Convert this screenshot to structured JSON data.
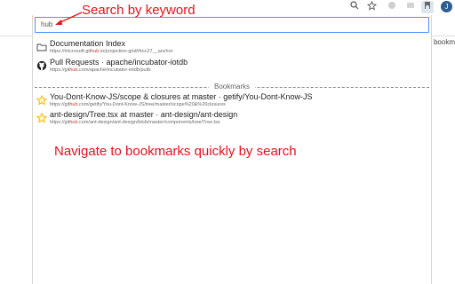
{
  "browser": {
    "toolbar_icons": [
      "search-icon",
      "star-icon",
      "extension-icon",
      "extension-icon",
      "bookmark-extension-icon",
      "profile-avatar"
    ],
    "avatar_letter": "J",
    "bookmarks_bar_fragment": "er bookm"
  },
  "search": {
    "value": "hub"
  },
  "annotations": {
    "search_hint": "Search by keyword",
    "navigate_hint": "Navigate to bookmarks quickly by search"
  },
  "results": [
    {
      "icon": "folder-icon",
      "title": "Documentation Index",
      "url_prefix": "https://microsoft.git",
      "url_hl": "hub",
      "url_suffix": ".io/projection-grid/#toc27__anchor"
    },
    {
      "icon": "github-icon",
      "title": "Pull Requests · apache/incubator-iotdb",
      "url_prefix": "https://git",
      "url_hl": "hub",
      "url_suffix": ".com/apache/incubator-iotdb/pulls"
    }
  ],
  "bookmarks_section": {
    "label": "Bookmarks",
    "items": [
      {
        "icon": "star-icon",
        "title": "You-Dont-Know-JS/scope & closures at master · getify/You-Dont-Know-JS",
        "url_prefix": "https://git",
        "url_hl": "hub",
        "url_suffix": ".com/getify/You-Dont-Know-JS/tree/master/scope%20&%20closures"
      },
      {
        "icon": "star-icon",
        "title": "ant-design/Tree.tsx at master · ant-design/ant-design",
        "url_prefix": "https://git",
        "url_hl": "hub",
        "url_suffix": ".com/ant-design/ant-design/blob/master/components/tree/Tree.tsx"
      }
    ]
  },
  "colors": {
    "annotation": "#e8101a",
    "search_border": "#4d90fe",
    "star": "#f5b400"
  }
}
